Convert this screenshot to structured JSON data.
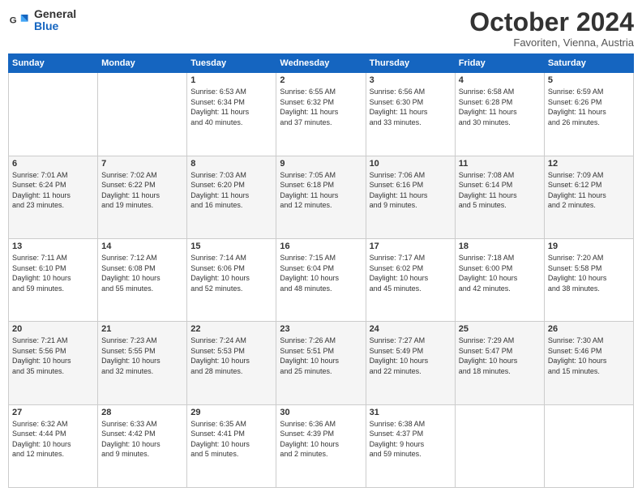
{
  "header": {
    "logo_general": "General",
    "logo_blue": "Blue",
    "month": "October 2024",
    "location": "Favoriten, Vienna, Austria"
  },
  "weekdays": [
    "Sunday",
    "Monday",
    "Tuesday",
    "Wednesday",
    "Thursday",
    "Friday",
    "Saturday"
  ],
  "weeks": [
    [
      {
        "day": "",
        "content": ""
      },
      {
        "day": "",
        "content": ""
      },
      {
        "day": "1",
        "content": "Sunrise: 6:53 AM\nSunset: 6:34 PM\nDaylight: 11 hours\nand 40 minutes."
      },
      {
        "day": "2",
        "content": "Sunrise: 6:55 AM\nSunset: 6:32 PM\nDaylight: 11 hours\nand 37 minutes."
      },
      {
        "day": "3",
        "content": "Sunrise: 6:56 AM\nSunset: 6:30 PM\nDaylight: 11 hours\nand 33 minutes."
      },
      {
        "day": "4",
        "content": "Sunrise: 6:58 AM\nSunset: 6:28 PM\nDaylight: 11 hours\nand 30 minutes."
      },
      {
        "day": "5",
        "content": "Sunrise: 6:59 AM\nSunset: 6:26 PM\nDaylight: 11 hours\nand 26 minutes."
      }
    ],
    [
      {
        "day": "6",
        "content": "Sunrise: 7:01 AM\nSunset: 6:24 PM\nDaylight: 11 hours\nand 23 minutes."
      },
      {
        "day": "7",
        "content": "Sunrise: 7:02 AM\nSunset: 6:22 PM\nDaylight: 11 hours\nand 19 minutes."
      },
      {
        "day": "8",
        "content": "Sunrise: 7:03 AM\nSunset: 6:20 PM\nDaylight: 11 hours\nand 16 minutes."
      },
      {
        "day": "9",
        "content": "Sunrise: 7:05 AM\nSunset: 6:18 PM\nDaylight: 11 hours\nand 12 minutes."
      },
      {
        "day": "10",
        "content": "Sunrise: 7:06 AM\nSunset: 6:16 PM\nDaylight: 11 hours\nand 9 minutes."
      },
      {
        "day": "11",
        "content": "Sunrise: 7:08 AM\nSunset: 6:14 PM\nDaylight: 11 hours\nand 5 minutes."
      },
      {
        "day": "12",
        "content": "Sunrise: 7:09 AM\nSunset: 6:12 PM\nDaylight: 11 hours\nand 2 minutes."
      }
    ],
    [
      {
        "day": "13",
        "content": "Sunrise: 7:11 AM\nSunset: 6:10 PM\nDaylight: 10 hours\nand 59 minutes."
      },
      {
        "day": "14",
        "content": "Sunrise: 7:12 AM\nSunset: 6:08 PM\nDaylight: 10 hours\nand 55 minutes."
      },
      {
        "day": "15",
        "content": "Sunrise: 7:14 AM\nSunset: 6:06 PM\nDaylight: 10 hours\nand 52 minutes."
      },
      {
        "day": "16",
        "content": "Sunrise: 7:15 AM\nSunset: 6:04 PM\nDaylight: 10 hours\nand 48 minutes."
      },
      {
        "day": "17",
        "content": "Sunrise: 7:17 AM\nSunset: 6:02 PM\nDaylight: 10 hours\nand 45 minutes."
      },
      {
        "day": "18",
        "content": "Sunrise: 7:18 AM\nSunset: 6:00 PM\nDaylight: 10 hours\nand 42 minutes."
      },
      {
        "day": "19",
        "content": "Sunrise: 7:20 AM\nSunset: 5:58 PM\nDaylight: 10 hours\nand 38 minutes."
      }
    ],
    [
      {
        "day": "20",
        "content": "Sunrise: 7:21 AM\nSunset: 5:56 PM\nDaylight: 10 hours\nand 35 minutes."
      },
      {
        "day": "21",
        "content": "Sunrise: 7:23 AM\nSunset: 5:55 PM\nDaylight: 10 hours\nand 32 minutes."
      },
      {
        "day": "22",
        "content": "Sunrise: 7:24 AM\nSunset: 5:53 PM\nDaylight: 10 hours\nand 28 minutes."
      },
      {
        "day": "23",
        "content": "Sunrise: 7:26 AM\nSunset: 5:51 PM\nDaylight: 10 hours\nand 25 minutes."
      },
      {
        "day": "24",
        "content": "Sunrise: 7:27 AM\nSunset: 5:49 PM\nDaylight: 10 hours\nand 22 minutes."
      },
      {
        "day": "25",
        "content": "Sunrise: 7:29 AM\nSunset: 5:47 PM\nDaylight: 10 hours\nand 18 minutes."
      },
      {
        "day": "26",
        "content": "Sunrise: 7:30 AM\nSunset: 5:46 PM\nDaylight: 10 hours\nand 15 minutes."
      }
    ],
    [
      {
        "day": "27",
        "content": "Sunrise: 6:32 AM\nSunset: 4:44 PM\nDaylight: 10 hours\nand 12 minutes."
      },
      {
        "day": "28",
        "content": "Sunrise: 6:33 AM\nSunset: 4:42 PM\nDaylight: 10 hours\nand 9 minutes."
      },
      {
        "day": "29",
        "content": "Sunrise: 6:35 AM\nSunset: 4:41 PM\nDaylight: 10 hours\nand 5 minutes."
      },
      {
        "day": "30",
        "content": "Sunrise: 6:36 AM\nSunset: 4:39 PM\nDaylight: 10 hours\nand 2 minutes."
      },
      {
        "day": "31",
        "content": "Sunrise: 6:38 AM\nSunset: 4:37 PM\nDaylight: 9 hours\nand 59 minutes."
      },
      {
        "day": "",
        "content": ""
      },
      {
        "day": "",
        "content": ""
      }
    ]
  ]
}
